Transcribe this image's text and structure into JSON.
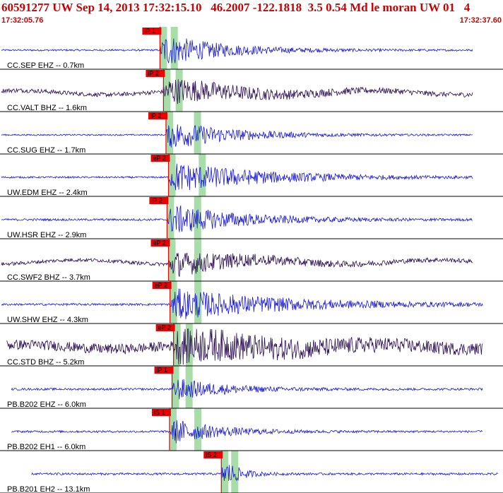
{
  "header": {
    "title": "60591277 UW Sep 14, 2013 17:32:15.10   46.2007 -122.1818  3.5 0.54 Md le moran UW 01   4",
    "time_start": "17:32:05.76",
    "time_end": "17:32:37.60"
  },
  "colors": {
    "title": "#cc0000",
    "trace_blue": "#1a1ad6",
    "trace_purple": "#2c0f52",
    "pick_box": "#ee0000",
    "pick_line": "#ee0000",
    "window_band": "#a8dca8",
    "divider": "#000000"
  },
  "chart_data": {
    "type": "line",
    "time_range": [
      "17:32:05.76",
      "17:32:37.60"
    ],
    "traces": [
      {
        "label": "CC.SEP EHZ -- 0.7km",
        "pick": "iP 1",
        "color": "trace_blue",
        "pick_frac": 0.318,
        "start_frac": 0.0,
        "end_frac": 0.94,
        "amp": 0.95,
        "noise": 0.05,
        "burst_frac": 0.32,
        "decay": 0.12
      },
      {
        "label": "CC.VALT BHZ -- 1.6km",
        "pick": "iP 2",
        "color": "trace_purple",
        "pick_frac": 0.325,
        "start_frac": 0.0,
        "end_frac": 0.94,
        "amp": 0.75,
        "noise": 0.12,
        "burst_frac": 0.33,
        "decay": 0.16
      },
      {
        "label": "CC.SUG EHZ -- 1.7km",
        "pick": "iP 2",
        "color": "trace_blue",
        "pick_frac": 0.33,
        "start_frac": 0.0,
        "end_frac": 0.94,
        "amp": 0.85,
        "noise": 0.04,
        "burst_frac": 0.37,
        "decay": 0.13
      },
      {
        "label": "UW.EDM EHZ -- 2.4km",
        "pick": "eP 2",
        "color": "trace_blue",
        "pick_frac": 0.335,
        "start_frac": 0.0,
        "end_frac": 0.94,
        "amp": 0.9,
        "noise": 0.05,
        "burst_frac": 0.38,
        "decay": 0.18
      },
      {
        "label": "UW.HSR EHZ -- 2.9km",
        "pick": "iP 2",
        "color": "trace_blue",
        "pick_frac": 0.332,
        "start_frac": 0.0,
        "end_frac": 0.94,
        "amp": 0.9,
        "noise": 0.06,
        "burst_frac": 0.37,
        "decay": 0.14
      },
      {
        "label": "CC.SWF2 BHZ -- 3.7km",
        "pick": "eP 2",
        "color": "trace_purple",
        "pick_frac": 0.335,
        "start_frac": 0.0,
        "end_frac": 0.94,
        "amp": 0.7,
        "noise": 0.1,
        "burst_frac": 0.37,
        "decay": 0.16
      },
      {
        "label": "UW.SHW EHZ -- 4.3km",
        "pick": "eP 2",
        "color": "trace_blue",
        "pick_frac": 0.338,
        "start_frac": 0.0,
        "end_frac": 0.96,
        "amp": 0.9,
        "noise": 0.06,
        "burst_frac": 0.37,
        "decay": 0.22
      },
      {
        "label": "CC.STD BHZ -- 5.2km",
        "pick": "eP 2",
        "color": "trace_purple",
        "pick_frac": 0.345,
        "start_frac": 0.01,
        "end_frac": 0.96,
        "amp": 0.95,
        "noise": 0.28,
        "burst_frac": 0.35,
        "decay": 0.22
      },
      {
        "label": "PB.B202 EHZ -- 6.0km",
        "pick": "iP 1",
        "color": "trace_blue",
        "pick_frac": 0.342,
        "start_frac": 0.02,
        "end_frac": 0.96,
        "amp": 0.65,
        "noise": 0.06,
        "burst_frac": 0.35,
        "decay": 0.1
      },
      {
        "label": "PB.B202 EH1 -- 6.0km",
        "pick": "iS 1",
        "color": "trace_blue",
        "pick_frac": 0.337,
        "start_frac": 0.02,
        "end_frac": 0.96,
        "amp": 0.75,
        "noise": 0.06,
        "burst_frac": 0.37,
        "decay": 0.09
      },
      {
        "label": "PB.B201 EH2 -- 13.1km",
        "pick": "iS 2",
        "color": "trace_blue",
        "pick_frac": 0.44,
        "start_frac": 0.06,
        "end_frac": 0.99,
        "amp": 1.0,
        "noise": 0.06,
        "burst_frac": 0.44,
        "decay": 0.03
      }
    ]
  }
}
